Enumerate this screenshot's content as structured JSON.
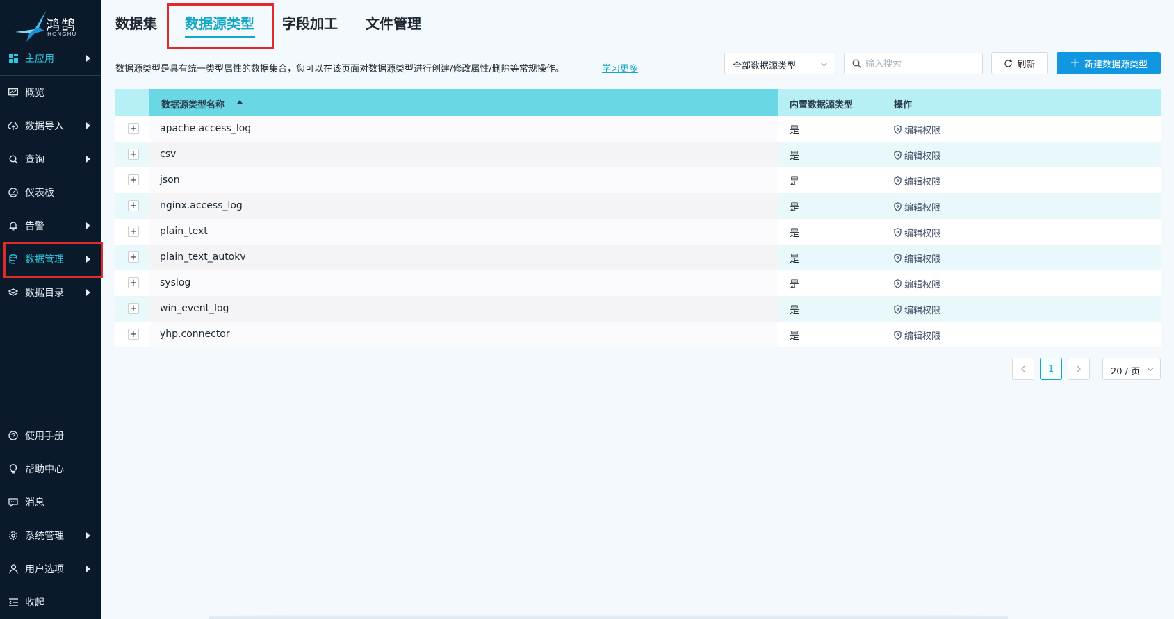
{
  "app": {
    "logo_text": "鸿鹄",
    "logo_sub": "HONGHU"
  },
  "sidebar": {
    "items": [
      {
        "label": "主应用",
        "icon": "dashboard-grid-icon",
        "arrow": true
      },
      {
        "label": "概览",
        "icon": "monitor-chart-icon",
        "arrow": false
      },
      {
        "label": "数据导入",
        "icon": "cloud-upload-icon",
        "arrow": true
      },
      {
        "label": "查询",
        "icon": "search-icon",
        "arrow": true
      },
      {
        "label": "仪表板",
        "icon": "gauge-icon",
        "arrow": false
      },
      {
        "label": "告警",
        "icon": "bell-icon",
        "arrow": true
      },
      {
        "label": "数据管理",
        "icon": "database-icon",
        "arrow": true
      },
      {
        "label": "数据目录",
        "icon": "layers-icon",
        "arrow": true
      }
    ],
    "bottom_items": [
      {
        "label": "使用手册",
        "icon": "question-circle-icon",
        "arrow": false
      },
      {
        "label": "帮助中心",
        "icon": "bulb-icon",
        "arrow": false
      },
      {
        "label": "消息",
        "icon": "message-icon",
        "arrow": false
      },
      {
        "label": "系统管理",
        "icon": "gear-icon",
        "arrow": true
      },
      {
        "label": "用户选项",
        "icon": "user-icon",
        "arrow": true
      },
      {
        "label": "收起",
        "icon": "collapse-menu-icon",
        "arrow": false
      }
    ]
  },
  "tabs": [
    {
      "label": "数据集"
    },
    {
      "label": "数据源类型"
    },
    {
      "label": "字段加工"
    },
    {
      "label": "文件管理"
    }
  ],
  "toolbar": {
    "description": "数据源类型是具有统一类型属性的数据集合，您可以在该页面对数据源类型进行创建/修改属性/删除等常规操作。",
    "learn_more": "学习更多",
    "filter_value": "全部数据源类型",
    "search_placeholder": "输入搜索",
    "refresh_label": "刷新",
    "new_label": "新建数据源类型"
  },
  "table": {
    "columns": [
      "数据源类型名称",
      "内置数据源类型",
      "操作"
    ],
    "rows": [
      {
        "name": "apache.access_log",
        "builtin": "是",
        "action": "编辑权限"
      },
      {
        "name": "csv",
        "builtin": "是",
        "action": "编辑权限"
      },
      {
        "name": "json",
        "builtin": "是",
        "action": "编辑权限"
      },
      {
        "name": "nginx.access_log",
        "builtin": "是",
        "action": "编辑权限"
      },
      {
        "name": "plain_text",
        "builtin": "是",
        "action": "编辑权限"
      },
      {
        "name": "plain_text_autokv",
        "builtin": "是",
        "action": "编辑权限"
      },
      {
        "name": "syslog",
        "builtin": "是",
        "action": "编辑权限"
      },
      {
        "name": "win_event_log",
        "builtin": "是",
        "action": "编辑权限"
      },
      {
        "name": "yhp.connector",
        "builtin": "是",
        "action": "编辑权限"
      }
    ]
  },
  "pagination": {
    "current_page": "1",
    "page_size": "20 / 页"
  },
  "colors": {
    "accent": "#13a8c8",
    "primary_button": "#1196e0",
    "sidebar_bg": "#0b1a2a",
    "highlight_box": "#e02b2b"
  }
}
